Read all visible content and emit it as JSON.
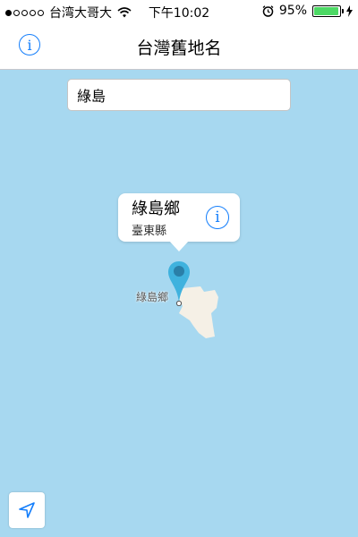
{
  "status_bar": {
    "carrier": "台湾大哥大",
    "time": "下午10:02",
    "battery": "95%",
    "battery_level": 0.95,
    "icons": [
      "signal-dots",
      "wifi-icon",
      "alarm-icon",
      "battery-icon",
      "charging-bolt-icon"
    ]
  },
  "nav": {
    "title": "台灣舊地名",
    "info_symbol": "i"
  },
  "search": {
    "value": "綠島"
  },
  "callout": {
    "title": "綠島鄉",
    "subtitle": "臺東縣",
    "info_symbol": "i"
  },
  "map": {
    "label": "綠島鄉",
    "colors": {
      "water": "#a7d8f0",
      "land": "#f5f0e6",
      "pin": "#3fb2de",
      "accent": "#147efb"
    }
  },
  "controls": {
    "locate_icon": "location-arrow-icon"
  }
}
